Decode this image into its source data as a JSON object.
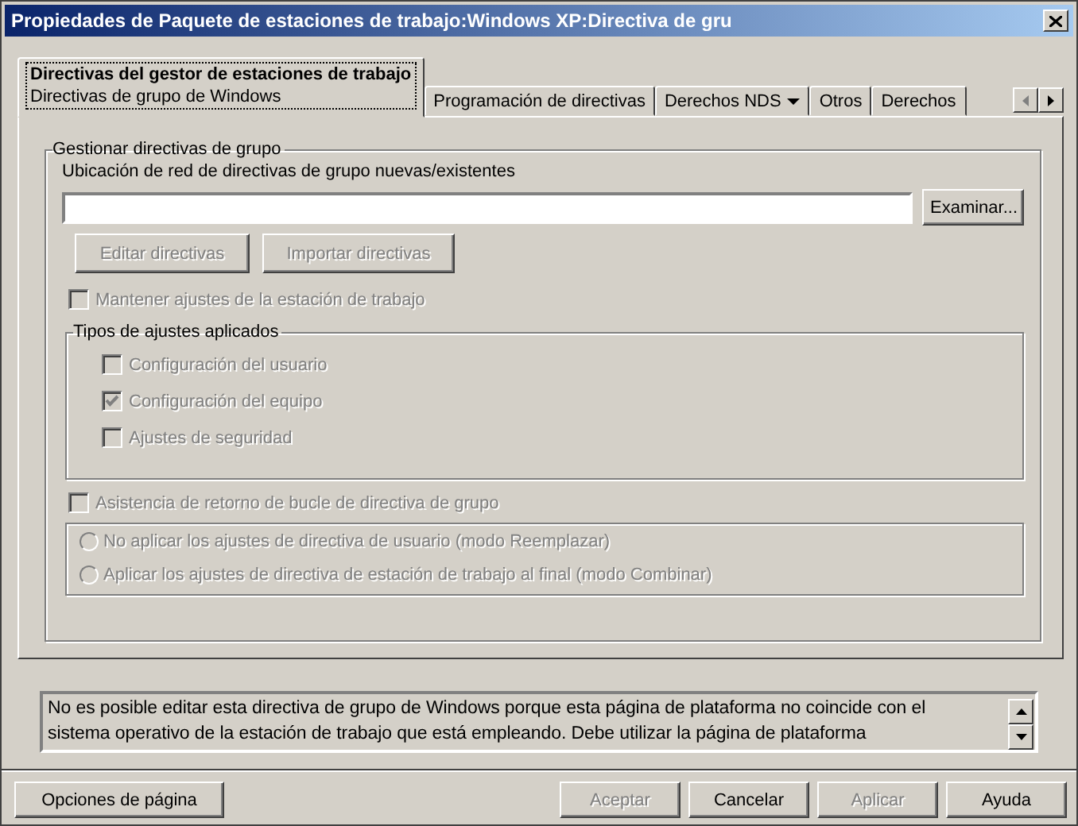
{
  "window": {
    "title": "Propiedades de Paquete de estaciones de trabajo:Windows XP:Directiva de gru"
  },
  "tabs": [
    {
      "label": "Directivas del gestor de estaciones de trabajo",
      "sublabel": "Directivas de grupo de Windows",
      "selected": true,
      "kind": "plain"
    },
    {
      "label": "Programación de directivas",
      "selected": false,
      "kind": "plain"
    },
    {
      "label": "Derechos NDS",
      "selected": false,
      "kind": "dropdown"
    },
    {
      "label": "Otros",
      "selected": false,
      "kind": "plain"
    },
    {
      "label": "Derechos",
      "selected": false,
      "kind": "plain"
    }
  ],
  "group": {
    "title": "Gestionar directivas de grupo",
    "location_label": "Ubicación de red de directivas de grupo nuevas/existentes",
    "browse_button": {
      "label": "Examinar...",
      "disabled": false
    },
    "action_buttons": [
      {
        "label": "Editar directivas",
        "disabled": true
      },
      {
        "label": "Importar directivas",
        "disabled": true
      }
    ],
    "keep_checkbox": {
      "label": "Mantener ajustes de la estación de trabajo",
      "checked": false,
      "disabled": true
    },
    "types": {
      "title": "Tipos de ajustes aplicados",
      "items": [
        {
          "label": "Configuración del usuario",
          "checked": false,
          "disabled": true
        },
        {
          "label": "Configuración del equipo",
          "checked": true,
          "disabled": true
        },
        {
          "label": "Ajustes de seguridad",
          "checked": false,
          "disabled": true
        }
      ]
    },
    "loopback_checkbox": {
      "label": "Asistencia de retorno de bucle de directiva de grupo",
      "checked": false,
      "disabled": true
    },
    "loopback_modes": [
      {
        "label": "No aplicar los ajustes de directiva de usuario (modo Reemplazar)",
        "selected": false,
        "disabled": true
      },
      {
        "label": "Aplicar los ajustes de directiva de estación de trabajo al final (modo Combinar)",
        "selected": false,
        "disabled": true
      }
    ]
  },
  "message": "No es posible editar esta directiva de grupo de Windows porque esta página de plataforma no coincide con el\nsistema operativo de la estación de trabajo que está empleando. Debe utilizar la página de plataforma",
  "page_options_button": {
    "label": "Opciones de página",
    "disabled": false
  },
  "buttons": [
    {
      "label": "Aceptar",
      "disabled": true
    },
    {
      "label": "Cancelar",
      "disabled": false
    },
    {
      "label": "Aplicar",
      "disabled": true
    },
    {
      "label": "Ayuda",
      "disabled": false
    }
  ]
}
